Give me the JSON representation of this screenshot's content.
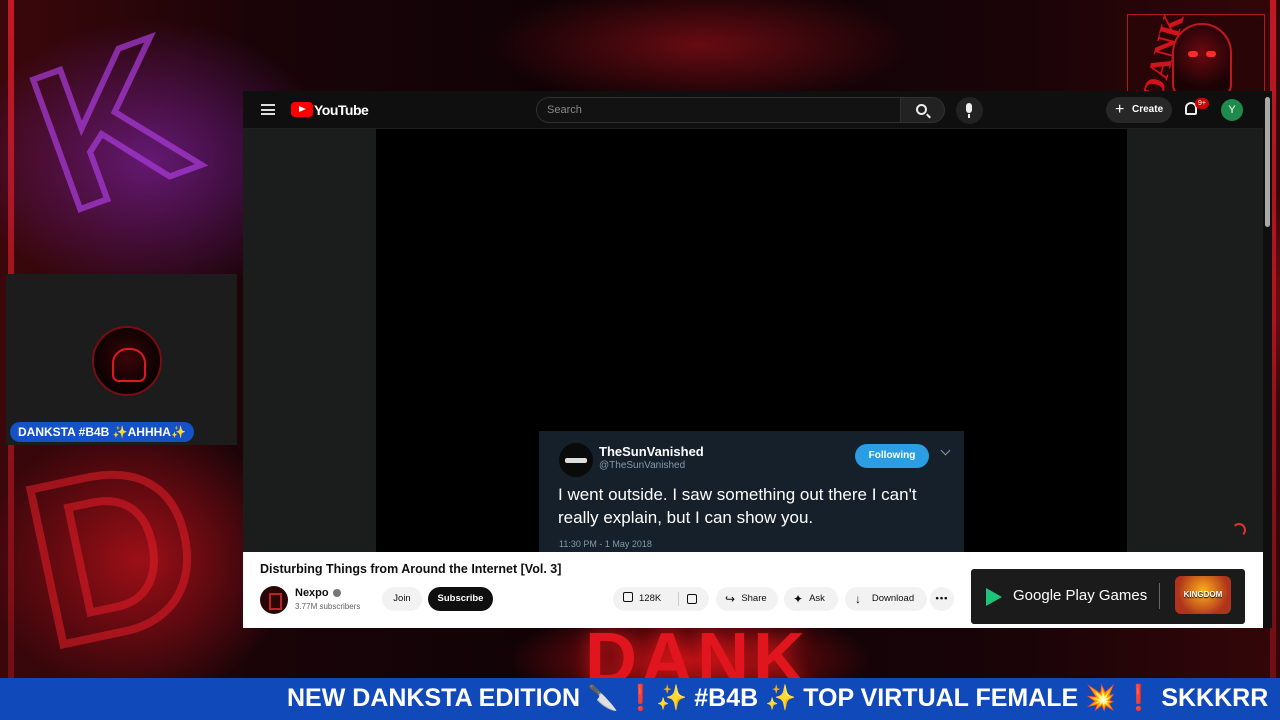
{
  "overlay": {
    "webcam_label": "DANKSTA #B4B ✨AHHHA✨",
    "ticker_text": "NEW DANKSTA EDITION 🔪 ❗✨ #B4B ✨ TOP VIRTUAL FEMALE 💥 ❗ SKKKRR",
    "background_word": "DANK",
    "logo_text": "DANK"
  },
  "youtube": {
    "logo_text": "YouTube",
    "search": {
      "placeholder": "Search"
    },
    "create_label": "Create",
    "notification_count": "9+",
    "avatar_letter": "Y",
    "tweet": {
      "name": "TheSunVanished",
      "handle": "@TheSunVanished",
      "follow_label": "Following",
      "text": "I went outside. I saw something out there I can't really explain, but I can show you.",
      "time": "11:30 PM - 1 May 2018"
    },
    "video": {
      "title": "Disturbing Things from Around the Internet [Vol. 3]",
      "channel": "Nexpo",
      "subscribers": "3.77M subscribers",
      "join_label": "Join",
      "subscribe_label": "Subscribe",
      "likes": "128K",
      "share_label": "Share",
      "ask_label": "Ask",
      "download_label": "Download",
      "more_label": "•••"
    },
    "ad": {
      "brand": "Google Play Games",
      "game": "KINGDOM"
    }
  },
  "colors": {
    "accent_red": "#ff0000",
    "ticker_blue": "#1049b9",
    "follow_blue": "#2a9de3"
  }
}
